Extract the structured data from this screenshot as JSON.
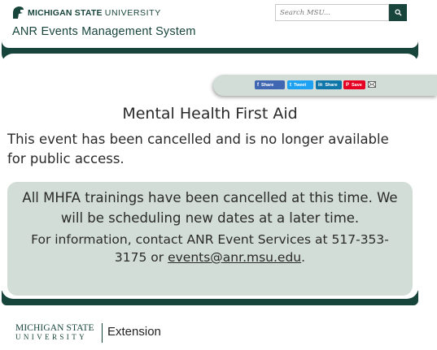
{
  "header": {
    "logo_bold": "MICHIGAN STATE",
    "logo_light": "UNIVERSITY",
    "search_placeholder": "Search MSU...",
    "app_title": "ANR Events Management System"
  },
  "share": {
    "facebook": "Share",
    "twitter": "Tweet",
    "linkedin": "Share",
    "pinterest": "Save"
  },
  "event": {
    "title": "Mental Health First Aid",
    "cancel_message": "This event has been cancelled and is no longer available for public access."
  },
  "notice": {
    "main": "All MHFA trainings have been cancelled at this time. We will be scheduling new dates at a later time.",
    "info_prefix": "For information, contact ANR Event Services at 517-353-3175 or ",
    "email": "events@anr.msu.edu",
    "info_suffix": "."
  },
  "footer": {
    "logo_line1": "MICHIGAN STATE",
    "logo_line2": "UNIVERSITY",
    "extension": "Extension"
  },
  "colors": {
    "brand_green": "#18453b",
    "notice_bg": "#d3ddd7"
  }
}
